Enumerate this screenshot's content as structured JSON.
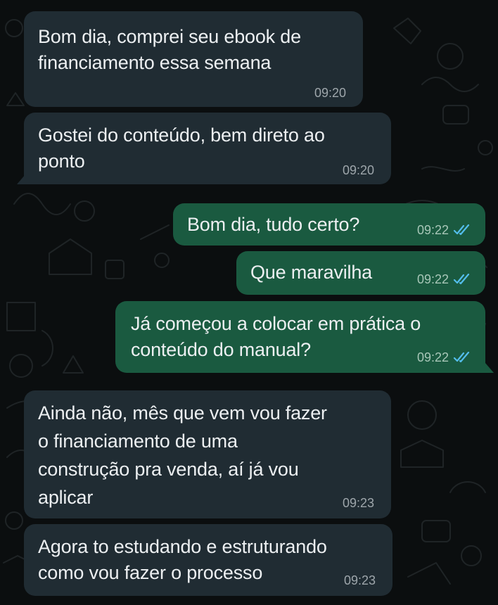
{
  "messages": [
    {
      "direction": "incoming",
      "text": "Bom dia, comprei seu ebook de\nfinanciamento essa semana",
      "time": "09:20"
    },
    {
      "direction": "incoming",
      "text": "Gostei do conteúdo, bem direto ao\nponto",
      "time": "09:20"
    },
    {
      "direction": "outgoing",
      "text": "Bom dia, tudo certo?",
      "time": "09:22",
      "status_icon": "double-check-read-icon"
    },
    {
      "direction": "outgoing",
      "text": "Que maravilha",
      "time": "09:22",
      "status_icon": "double-check-read-icon"
    },
    {
      "direction": "outgoing",
      "text": "Já começou a colocar em prática o\nconteúdo do manual?",
      "time": "09:22",
      "status_icon": "double-check-read-icon"
    },
    {
      "direction": "incoming",
      "text": "Ainda não, mês que vem vou fazer\no financiamento de uma\nconstrução pra venda, aí já vou\naplicar",
      "time": "09:23"
    },
    {
      "direction": "incoming",
      "text": "Agora to estudando e estruturando\ncomo vou fazer o processo",
      "time": "09:23"
    }
  ],
  "colors": {
    "background": "#0b0e0f",
    "incoming_bubble": "#202c33",
    "outgoing_bubble": "#1a5a40",
    "message_text": "#eceff1",
    "read_tick": "#53bdeb"
  }
}
